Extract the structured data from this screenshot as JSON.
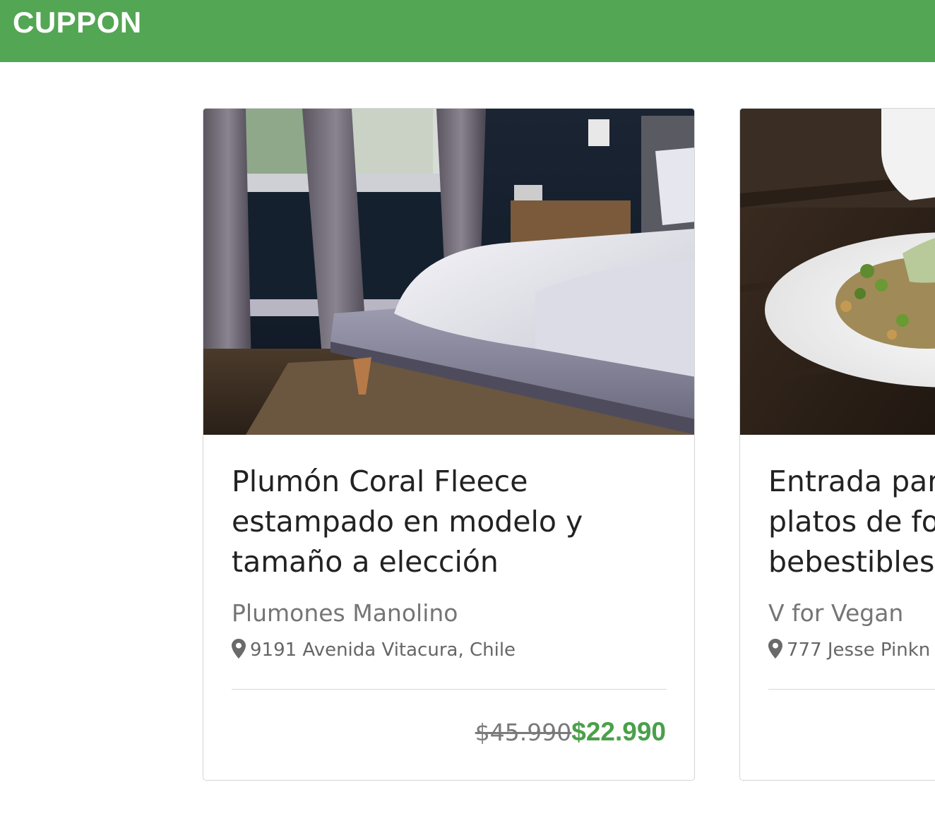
{
  "header": {
    "brand": "CUPPON",
    "background_color": "#53a653"
  },
  "deals": [
    {
      "title_lines": [
        "Plumón Coral Fleece",
        "estampado en modelo y",
        "tamaño a elección"
      ],
      "merchant": "Plumones Manolino",
      "location_icon": "map-pin-icon",
      "location": "9191 Avenida Vitacura, Chile",
      "old_price": "$45.990",
      "new_price": "$22.990",
      "image": "bedroom-photo"
    },
    {
      "title_lines": [
        "Entrada par",
        "platos de fo",
        "bebestibles"
      ],
      "merchant": "V for Vegan",
      "location_icon": "map-pin-icon",
      "location": "777 Jesse Pinkn",
      "image": "vegan-salad-photo"
    }
  ],
  "colors": {
    "accent": "#53a653",
    "price": "#4aa04a"
  }
}
